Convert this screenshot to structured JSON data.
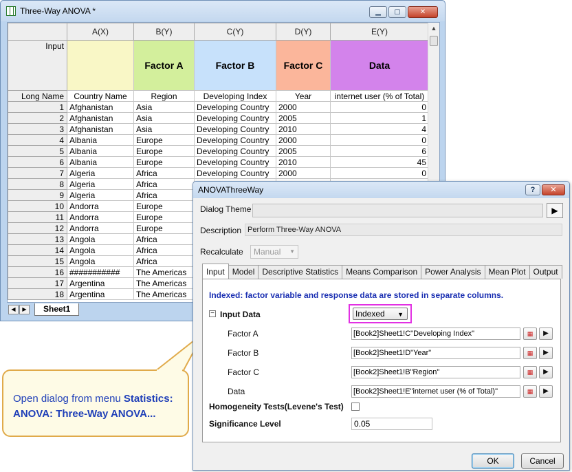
{
  "worksheet": {
    "title": "Three-Way ANOVA *",
    "window_buttons": {
      "minimize": "▁",
      "maximize": "▢",
      "close": "✕"
    },
    "column_headers": [
      "A(X)",
      "B(Y)",
      "C(Y)",
      "D(Y)",
      "E(Y)"
    ],
    "input_row": {
      "label": "Input",
      "cells": [
        "",
        "Factor A",
        "Factor B",
        "Factor C",
        "Data"
      ],
      "colors": [
        "#f9f7c6",
        "#d3ef9c",
        "#c7e1fb",
        "#fbb69b",
        "#d383eb"
      ]
    },
    "long_name_row": {
      "label": "Long Name",
      "cells": [
        "Country Name",
        "Region",
        "Developing Index",
        "Year",
        "internet user (% of Total)"
      ]
    },
    "rows": [
      [
        "1",
        "Afghanistan",
        "Asia",
        "Developing Country",
        "2000",
        "0"
      ],
      [
        "2",
        "Afghanistan",
        "Asia",
        "Developing Country",
        "2005",
        "1"
      ],
      [
        "3",
        "Afghanistan",
        "Asia",
        "Developing Country",
        "2010",
        "4"
      ],
      [
        "4",
        "Albania",
        "Europe",
        "Developing Country",
        "2000",
        "0"
      ],
      [
        "5",
        "Albania",
        "Europe",
        "Developing Country",
        "2005",
        "6"
      ],
      [
        "6",
        "Albania",
        "Europe",
        "Developing Country",
        "2010",
        "45"
      ],
      [
        "7",
        "Algeria",
        "Africa",
        "Developing Country",
        "2000",
        "0"
      ],
      [
        "8",
        "Algeria",
        "Africa",
        "",
        "",
        ""
      ],
      [
        "9",
        "Algeria",
        "Africa",
        "",
        "",
        ""
      ],
      [
        "10",
        "Andorra",
        "Europe",
        "",
        "",
        ""
      ],
      [
        "11",
        "Andorra",
        "Europe",
        "",
        "",
        ""
      ],
      [
        "12",
        "Andorra",
        "Europe",
        "",
        "",
        ""
      ],
      [
        "13",
        "Angola",
        "Africa",
        "",
        "",
        ""
      ],
      [
        "14",
        "Angola",
        "Africa",
        "",
        "",
        ""
      ],
      [
        "15",
        "Angola",
        "Africa",
        "",
        "",
        ""
      ],
      [
        "16",
        "###########",
        "The Americas",
        "",
        "",
        ""
      ],
      [
        "17",
        "Argentina",
        "The Americas",
        "",
        "",
        ""
      ],
      [
        "18",
        "Argentina",
        "The Americas",
        "",
        "",
        ""
      ]
    ],
    "sheet_tab": "Sheet1",
    "sheet_nav": [
      "◀",
      "▶"
    ]
  },
  "callout": {
    "prefix": "Open dialog from menu ",
    "bold1": "Statistics:",
    "bold2": "ANOVA: Three-Way ANOVA..."
  },
  "dialog": {
    "title": "ANOVAThreeWay",
    "help_label": "?",
    "close_label": "✕",
    "theme_label": "Dialog Theme",
    "theme_value": "",
    "theme_arrow": "▶",
    "description_label": "Description",
    "description_value": "Perform Three-Way ANOVA",
    "recalculate_label": "Recalculate",
    "recalculate_value": "Manual",
    "tabs": [
      "Input",
      "Model",
      "Descriptive Statistics",
      "Means Comparison",
      "Power Analysis",
      "Mean Plot",
      "Output"
    ],
    "active_tab": "Input",
    "info_line": "Indexed: factor variable and response data are stored in separate columns.",
    "input_data_label": "Input Data",
    "collapse_symbol": "−",
    "input_mode_value": "Indexed",
    "fields": [
      {
        "label": "Factor A",
        "value": "[Book2]Sheet1!C\"Developing Index\""
      },
      {
        "label": "Factor B",
        "value": "[Book2]Sheet1!D\"Year\""
      },
      {
        "label": "Factor C",
        "value": "[Book2]Sheet1!B\"Region\""
      },
      {
        "label": "Data",
        "value": "[Book2]Sheet1!E\"internet user (% of Total)\""
      }
    ],
    "homogeneity_label": "Homogeneity Tests(Levene's Test)",
    "homogeneity_checked": false,
    "significance_label": "Significance Level",
    "significance_value": "0.05",
    "ok_label": "OK",
    "cancel_label": "Cancel"
  }
}
